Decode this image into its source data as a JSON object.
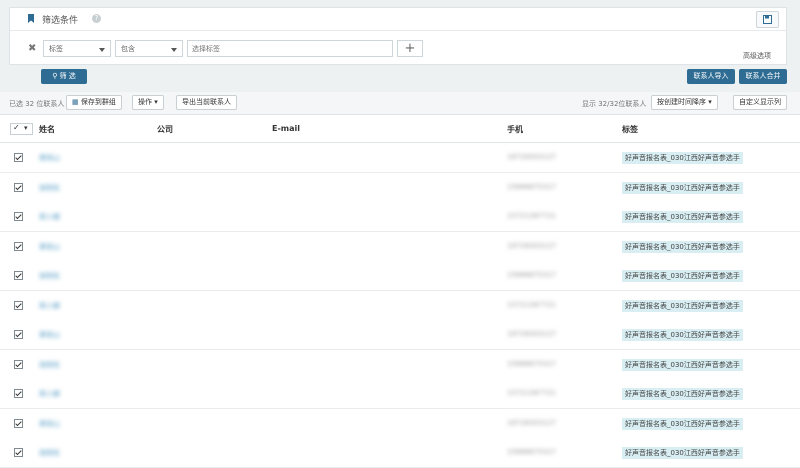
{
  "filter": {
    "title": "筛选条件",
    "help": "?",
    "field_select": "标签",
    "operator_select": "包含",
    "value_placeholder": "选择标签",
    "add": "+",
    "advanced_link": "高级选项",
    "filter_button": "筛 选",
    "import_button": "联系人导入",
    "merge_button": "联系人合并"
  },
  "toolbar": {
    "selected_text": "已选 32 位联系人",
    "save_group": "保存到群组",
    "actions": "操作",
    "export": "导出当前联系人",
    "showing_text": "显示 32/32位联系人",
    "sort": "按创建时间降序",
    "custom_columns": "自定义显示列"
  },
  "table": {
    "columns": [
      "姓名",
      "公司",
      "E-mail",
      "手机",
      "标签"
    ],
    "rows": [
      {
        "name": "黄雨山",
        "phone": "18728303127",
        "tag": "好声音报名表_030江西好声音参选手"
      },
      {
        "name": "胡雨松",
        "phone": "15886875317",
        "tag": "好声音报名表_030江西好声音参选手"
      },
      {
        "name": "蒋小娜",
        "phone": "15721387721",
        "tag": "好声音报名表_030江西好声音参选手"
      },
      {
        "name": "黄雨山",
        "phone": "18728303127",
        "tag": "好声音报名表_030江西好声音参选手"
      },
      {
        "name": "胡雨松",
        "phone": "15886875317",
        "tag": "好声音报名表_030江西好声音参选手"
      },
      {
        "name": "蒋小娜",
        "phone": "15721387721",
        "tag": "好声音报名表_030江西好声音参选手"
      },
      {
        "name": "黄雨山",
        "phone": "18728303127",
        "tag": "好声音报名表_030江西好声音参选手"
      },
      {
        "name": "胡雨松",
        "phone": "15886875317",
        "tag": "好声音报名表_030江西好声音参选手"
      },
      {
        "name": "蒋小娜",
        "phone": "15721387721",
        "tag": "好声音报名表_030江西好声音参选手"
      },
      {
        "name": "黄雨山",
        "phone": "18728303127",
        "tag": "好声音报名表_030江西好声音参选手"
      },
      {
        "name": "胡雨松",
        "phone": "15886875317",
        "tag": "好声音报名表_030江西好声音参选手"
      }
    ]
  },
  "colors": {
    "primary": "#2f6c93",
    "tag_bg": "#d8eef3",
    "link": "#5a9fc6"
  }
}
